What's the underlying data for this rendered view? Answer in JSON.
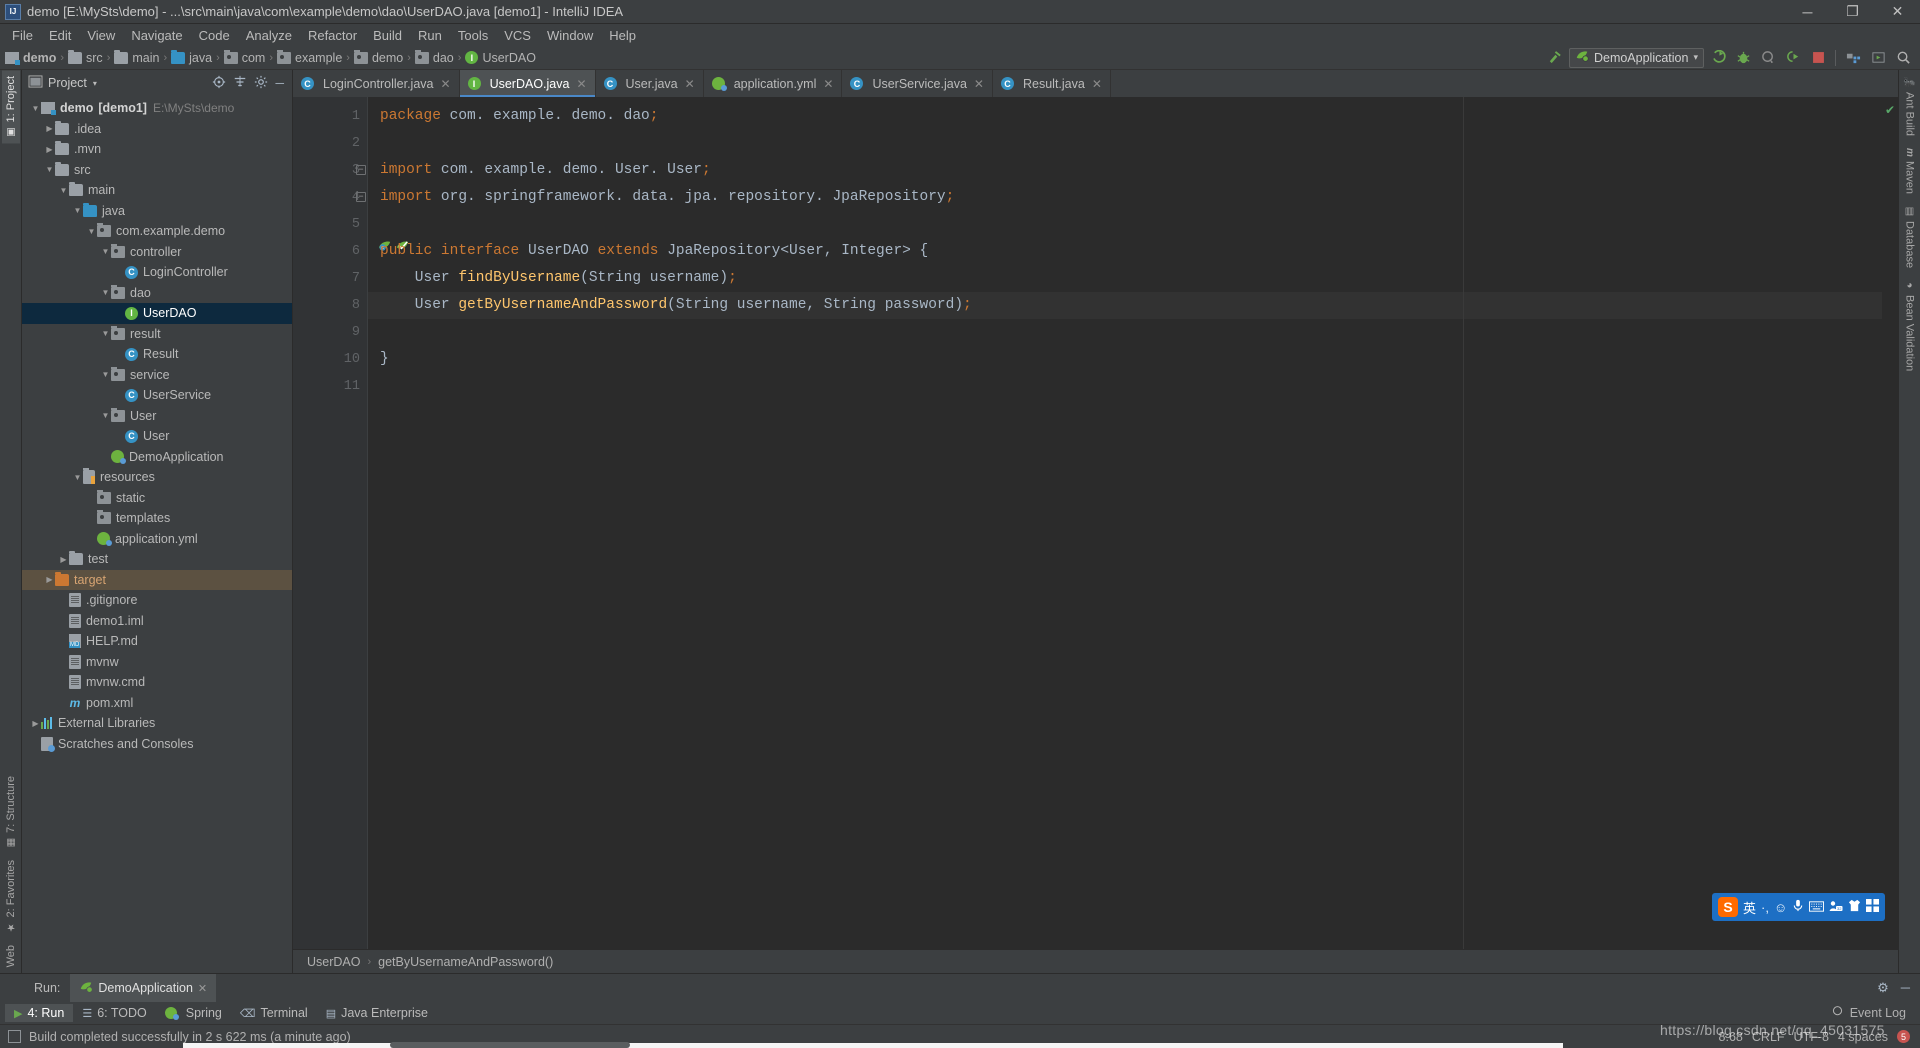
{
  "window": {
    "title": "demo [E:\\MySts\\demo] - ...\\src\\main\\java\\com\\example\\demo\\dao\\UserDAO.java [demo1] - IntelliJ IDEA",
    "minimize": "─",
    "maximize": "❐",
    "close": "✕"
  },
  "menu": {
    "items": [
      "File",
      "Edit",
      "View",
      "Navigate",
      "Code",
      "Analyze",
      "Refactor",
      "Build",
      "Run",
      "Tools",
      "VCS",
      "Window",
      "Help"
    ]
  },
  "breadcrumb": {
    "items": [
      {
        "label": "demo",
        "icon": "module-icon"
      },
      {
        "label": "src",
        "icon": "folder-icon"
      },
      {
        "label": "main",
        "icon": "folder-icon"
      },
      {
        "label": "java",
        "icon": "source-folder-icon"
      },
      {
        "label": "com",
        "icon": "package-icon"
      },
      {
        "label": "example",
        "icon": "package-icon"
      },
      {
        "label": "demo",
        "icon": "package-icon"
      },
      {
        "label": "dao",
        "icon": "package-icon"
      },
      {
        "label": "UserDAO",
        "icon": "interface-icon"
      }
    ],
    "separator": "›"
  },
  "toolbar": {
    "build_hammer": "⚒",
    "run_config": "DemoApplication",
    "dropdown_caret": "▾",
    "run": "▶",
    "debug": "🐞",
    "run_coverage": "◔",
    "profile": "▷",
    "stop": "■",
    "build_project": "▣",
    "select_run": "▷",
    "search": "🔍"
  },
  "left_tool_tabs": [
    {
      "label": "1: Project",
      "active": true
    },
    {
      "label": "7: Structure",
      "active": false
    },
    {
      "label": "2: Favorites",
      "active": false
    },
    {
      "label": "Web",
      "active": false
    }
  ],
  "right_tool_tabs": [
    {
      "label": "Ant Build"
    },
    {
      "label": "Maven"
    },
    {
      "label": "Database"
    },
    {
      "label": "Bean Validation"
    }
  ],
  "project_panel": {
    "title": "Project",
    "caret": "▾",
    "actions": [
      "locate-icon",
      "collapse-icon",
      "settings-icon",
      "hide-icon"
    ],
    "tree": [
      {
        "indent": 0,
        "arrow": "▼",
        "icon": "module-icon",
        "label": "demo",
        "bold": true,
        "suffix": "[demo1]",
        "path": "E:\\MySts\\demo"
      },
      {
        "indent": 1,
        "arrow": "▶",
        "icon": "folder-icon",
        "label": ".idea"
      },
      {
        "indent": 1,
        "arrow": "▶",
        "icon": "folder-icon",
        "label": ".mvn"
      },
      {
        "indent": 1,
        "arrow": "▼",
        "icon": "folder-icon",
        "label": "src"
      },
      {
        "indent": 2,
        "arrow": "▼",
        "icon": "folder-icon",
        "label": "main"
      },
      {
        "indent": 3,
        "arrow": "▼",
        "icon": "source-folder-icon",
        "label": "java"
      },
      {
        "indent": 4,
        "arrow": "▼",
        "icon": "package-icon",
        "label": "com.example.demo"
      },
      {
        "indent": 5,
        "arrow": "▼",
        "icon": "package-icon",
        "label": "controller"
      },
      {
        "indent": 6,
        "arrow": "",
        "icon": "class-icon",
        "label": "LoginController"
      },
      {
        "indent": 5,
        "arrow": "▼",
        "icon": "package-icon",
        "label": "dao"
      },
      {
        "indent": 6,
        "arrow": "",
        "icon": "interface-icon",
        "label": "UserDAO",
        "selected": true
      },
      {
        "indent": 5,
        "arrow": "▼",
        "icon": "package-icon",
        "label": "result"
      },
      {
        "indent": 6,
        "arrow": "",
        "icon": "class-icon",
        "label": "Result"
      },
      {
        "indent": 5,
        "arrow": "▼",
        "icon": "package-icon",
        "label": "service"
      },
      {
        "indent": 6,
        "arrow": "",
        "icon": "class-icon",
        "label": "UserService"
      },
      {
        "indent": 5,
        "arrow": "▼",
        "icon": "package-icon",
        "label": "User"
      },
      {
        "indent": 6,
        "arrow": "",
        "icon": "class-icon",
        "label": "User"
      },
      {
        "indent": 5,
        "arrow": "",
        "icon": "spring-icon",
        "label": "DemoApplication"
      },
      {
        "indent": 3,
        "arrow": "▼",
        "icon": "resources-icon",
        "label": "resources"
      },
      {
        "indent": 4,
        "arrow": "",
        "icon": "package-icon",
        "label": "static"
      },
      {
        "indent": 4,
        "arrow": "",
        "icon": "package-icon",
        "label": "templates"
      },
      {
        "indent": 4,
        "arrow": "",
        "icon": "spring-icon",
        "label": "application.yml"
      },
      {
        "indent": 2,
        "arrow": "▶",
        "icon": "folder-icon",
        "label": "test"
      },
      {
        "indent": 1,
        "arrow": "▶",
        "icon": "folder-orange-icon",
        "label": "target",
        "target": true
      },
      {
        "indent": 2,
        "arrow": "",
        "icon": "text-file-icon",
        "label": ".gitignore"
      },
      {
        "indent": 2,
        "arrow": "",
        "icon": "iml-file-icon",
        "label": "demo1.iml"
      },
      {
        "indent": 2,
        "arrow": "",
        "icon": "markdown-file-icon",
        "label": "HELP.md"
      },
      {
        "indent": 2,
        "arrow": "",
        "icon": "text-file-icon",
        "label": "mvnw"
      },
      {
        "indent": 2,
        "arrow": "",
        "icon": "text-file-icon",
        "label": "mvnw.cmd"
      },
      {
        "indent": 2,
        "arrow": "",
        "icon": "maven-file-icon",
        "label": "pom.xml"
      },
      {
        "indent": 0,
        "arrow": "▶",
        "icon": "libraries-icon",
        "label": "External Libraries"
      },
      {
        "indent": 0,
        "arrow": "",
        "icon": "scratches-icon",
        "label": "Scratches and Consoles"
      }
    ]
  },
  "editor": {
    "tabs": [
      {
        "label": "LoginController.java",
        "icon": "class-icon",
        "active": false
      },
      {
        "label": "UserDAO.java",
        "icon": "interface-icon",
        "active": true
      },
      {
        "label": "User.java",
        "icon": "class-icon",
        "active": false
      },
      {
        "label": "application.yml",
        "icon": "spring-icon",
        "active": false
      },
      {
        "label": "UserService.java",
        "icon": "class-icon",
        "active": false
      },
      {
        "label": "Result.java",
        "icon": "class-icon",
        "active": false
      }
    ],
    "close_glyph": "✕",
    "line_numbers": [
      "1",
      "2",
      "3",
      "4",
      "5",
      "6",
      "7",
      "8",
      "9",
      "10",
      "11"
    ],
    "lines": [
      {
        "n": 1,
        "tokens": [
          {
            "t": "package",
            "c": "kw"
          },
          {
            "t": " com. example. demo. dao",
            "c": "pm"
          },
          {
            "t": ";",
            "c": "sem"
          }
        ]
      },
      {
        "n": 2,
        "tokens": []
      },
      {
        "n": 3,
        "tokens": [
          {
            "t": "import",
            "c": "kw"
          },
          {
            "t": " com. example. demo. User. User",
            "c": "pm"
          },
          {
            "t": ";",
            "c": "sem"
          }
        ],
        "fold": true
      },
      {
        "n": 4,
        "tokens": [
          {
            "t": "import",
            "c": "kw"
          },
          {
            "t": " org. springframework. data. jpa. repository. JpaRepository",
            "c": "pm"
          },
          {
            "t": ";",
            "c": "sem"
          }
        ],
        "fold": true
      },
      {
        "n": 5,
        "tokens": []
      },
      {
        "n": 6,
        "tokens": [
          {
            "t": "public",
            "c": "kw"
          },
          {
            "t": " ",
            "c": "pm"
          },
          {
            "t": "interface",
            "c": "kw"
          },
          {
            "t": " UserDAO ",
            "c": "pm"
          },
          {
            "t": "extends",
            "c": "kw"
          },
          {
            "t": " JpaRepository<User, Integer> {",
            "c": "pm"
          }
        ],
        "gutter_marks": [
          "spring-bean-icon",
          "impl-check-icon"
        ]
      },
      {
        "n": 7,
        "tokens": [
          {
            "t": "    User ",
            "c": "pm"
          },
          {
            "t": "findByUsername",
            "c": "mth"
          },
          {
            "t": "(String username)",
            "c": "pm"
          },
          {
            "t": ";",
            "c": "sem"
          }
        ]
      },
      {
        "n": 8,
        "tokens": [
          {
            "t": "    User ",
            "c": "pm"
          },
          {
            "t": "getByUsernameAndPassword",
            "c": "mth"
          },
          {
            "t": "(String username, String password)",
            "c": "pm"
          },
          {
            "t": ";",
            "c": "sem"
          }
        ],
        "highlight": true
      },
      {
        "n": 9,
        "tokens": []
      },
      {
        "n": 10,
        "tokens": [
          {
            "t": "}",
            "c": "pm"
          }
        ]
      },
      {
        "n": 11,
        "tokens": []
      }
    ],
    "inspection_ok": "✔"
  },
  "editor_breadcrumb": {
    "items": [
      "UserDAO",
      "getByUsernameAndPassword()"
    ],
    "separator": "›"
  },
  "run_window": {
    "label": "Run:",
    "tab": "DemoApplication",
    "close_glyph": "✕",
    "settings_glyph": "⚙",
    "hide_glyph": "─"
  },
  "status_tabs": [
    {
      "label": "4: Run",
      "icon": "run-icon",
      "active": true
    },
    {
      "label": "6: TODO",
      "icon": "todo-icon",
      "active": false
    },
    {
      "label": "Spring",
      "icon": "spring-icon",
      "active": false
    },
    {
      "label": "Terminal",
      "icon": "terminal-icon",
      "active": false
    },
    {
      "label": "Java Enterprise",
      "icon": "jee-icon",
      "active": false
    }
  ],
  "event_log": {
    "label": "Event Log",
    "icon": "balloon-icon"
  },
  "statusbar": {
    "message": "Build completed successfully in 2 s 622 ms (a minute ago)",
    "position": "8:68",
    "encoding": "UTF-8",
    "line_separator": "CRLF",
    "indent": "4 spaces",
    "error_count": "5"
  },
  "ime": {
    "logo": "S",
    "mode": "英",
    "items": [
      "punctuation-icon",
      "emoji-icon",
      "mic-icon",
      "keyboard-icon",
      "user-icon",
      "skin-icon",
      "apps-icon"
    ],
    "glyphs": [
      "·,",
      "☺",
      "ම",
      "⌨",
      "⛃",
      "👕",
      "▒"
    ]
  },
  "watermark": {
    "text": "https://blog.csdn.net/qq_45031575"
  }
}
